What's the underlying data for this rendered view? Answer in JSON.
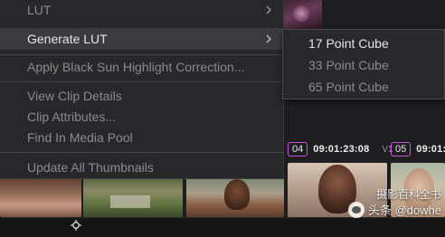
{
  "context_menu": {
    "items": [
      {
        "label": "LUT",
        "has_submenu": true
      },
      {
        "label": "Generate LUT",
        "has_submenu": true,
        "highlighted": true
      },
      {
        "label": "Apply Black Sun Highlight Correction..."
      },
      {
        "label": "View Clip Details"
      },
      {
        "label": "Clip Attributes..."
      },
      {
        "label": "Find In Media Pool"
      },
      {
        "label": "Update All Thumbnails"
      }
    ]
  },
  "submenu": {
    "items": [
      {
        "label": "17 Point Cube"
      },
      {
        "label": "33 Point Cube"
      },
      {
        "label": "65 Point Cube"
      }
    ]
  },
  "clips": [
    {
      "number": "04",
      "timecode": "09:01:23:08",
      "track": "V1",
      "badge_color": "#c455d6"
    },
    {
      "number": "05",
      "timecode": "09:01:29",
      "badge_color": "#c455d6"
    }
  ],
  "watermark": {
    "text": "头条 @dowhe",
    "overlay_text": "摄影百科全书"
  },
  "icons": {
    "chevron": "chevron-right-icon",
    "cursor": "crosshair-cursor-icon",
    "watermark": "wechat-logo-icon"
  }
}
